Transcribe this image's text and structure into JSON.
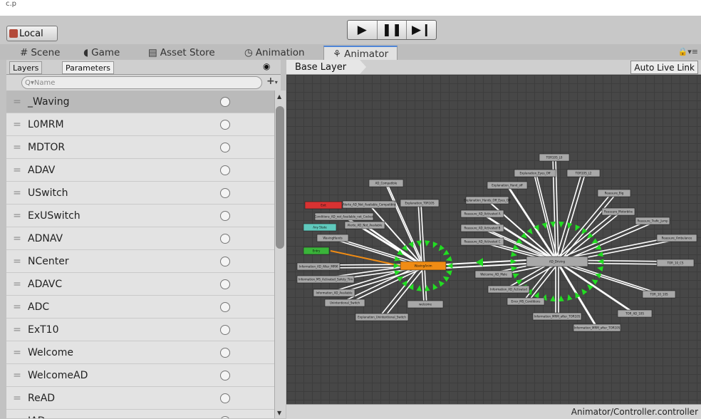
{
  "top_strip_text": "c.p",
  "toolbar": {
    "local_label": "Local",
    "play_icon": "play-icon",
    "pause_icon": "pause-icon",
    "step_icon": "step-icon"
  },
  "tabs": [
    {
      "label": "Scene",
      "glyph": "#"
    },
    {
      "label": "Game",
      "glyph": "◖"
    },
    {
      "label": "Asset Store",
      "glyph": "▤"
    },
    {
      "label": "Animation",
      "glyph": "◷"
    },
    {
      "label": "Animator",
      "glyph": "⚘"
    }
  ],
  "left_panel": {
    "layers_tab": "Layers",
    "parameters_tab": "Parameters",
    "search_placeholder": "Q▾Name",
    "parameters": [
      "_Waving",
      "L0MRM",
      "MDTOR",
      "ADAV",
      "USwitch",
      "ExUSwitch",
      "ADNAV",
      "NCenter",
      "ADAVC",
      "ADC",
      "ExT10",
      "Welcome",
      "WelcomeAD",
      "ReAD",
      "IADac"
    ]
  },
  "graph": {
    "breadcrumb": "Base Layer",
    "auto_live_link": "Auto Live Link",
    "colors": {
      "grid_bg": "#474747",
      "state": "#a8a8a8",
      "default_state": "#f08c14",
      "any_state": "#5fc9bd",
      "entry": "#3ab43a",
      "exit": "#d83232",
      "transition": "#ffffff",
      "arrow": "#22dd22"
    },
    "hubs": [
      {
        "name": "WavingAnim",
        "kind": "default",
        "states": [
          "AD_Compatible",
          "Alerte_AD_Not_Available_Compatible",
          "Explanation_T0R10S",
          "Conditions_AD_not_Available_not_Cocked",
          "Alerte_AD_Not_Available",
          "WavingHands",
          "Information_AD_After_MRM",
          "Information_MS_Activated_Safety_Tim",
          "Information_AD_Available",
          "Unintentional_Switch",
          "welcome",
          "Explanation_Unintentional_Switch"
        ]
      },
      {
        "name": "AD_Driving",
        "kind": "state",
        "states": [
          "TOR10S_L0",
          "Explanation_Eyes_Off",
          "TOR10S_L2",
          "Explanation_Hand_off",
          "Explanation_Hands_Off_Eyes_Off",
          "Reassure_Big",
          "Reassure_AD_Activated A",
          "Reassure_Motorbike",
          "Reassure_AD_Activated B",
          "Reassure_Trafic_Jump",
          "Reassure_AD_Activated C",
          "Reassure_Ambulance",
          "Welcome_AD_Male",
          "TOR_10_CS",
          "Information_AD_Activated",
          "TOR_10_10S",
          "Error_MS_Conditions",
          "TOR_AD_10S",
          "Information_MRM_after_TOR10S",
          "Information_MRM_after_TOR10S"
        ]
      }
    ],
    "specials": [
      {
        "name": "Exit",
        "kind": "exit"
      },
      {
        "name": "Any State",
        "kind": "any"
      },
      {
        "name": "Entry",
        "kind": "entry"
      }
    ]
  },
  "status_bar": "Animator/Controller.controller"
}
